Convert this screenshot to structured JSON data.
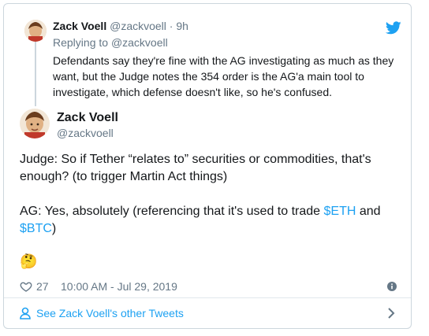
{
  "parent_tweet": {
    "author_name": "Zack Voell",
    "author_handle": "@zackvoell",
    "separator": "·",
    "time_ago": "9h",
    "replying_to_label": "Replying to",
    "replying_to_handle": "@zackvoell",
    "text_lines": [
      "Defendants say they're fine with the AG investigating as much as they",
      "want, but the Judge notes the 354 order is the AG'a main tool to",
      "investigate, which defense doesn't like, so he's confused."
    ]
  },
  "main_tweet": {
    "author_name": "Zack Voell",
    "author_handle": "@zackvoell",
    "paragraph1_lines": [
      "Judge: So if Tether “relates to” securities or commodities, that's",
      "enough? (to trigger Martin Act things)"
    ],
    "paragraph2_prefix": "AG: Yes, absolutely (referencing that it's used to trade ",
    "cashtag_eth": "$ETH",
    "paragraph2_mid": " and",
    "cashtag_btc": "$BTC",
    "paragraph2_suffix": ")",
    "emoji": "🤔"
  },
  "meta": {
    "like_count": "27",
    "timestamp": "10:00 AM - Jul 29, 2019"
  },
  "footer": {
    "see_more_label": "See Zack Voell's other Tweets"
  },
  "colors": {
    "brand_blue": "#1da1f2",
    "muted": "#657786",
    "border": "#ccd6dd"
  }
}
